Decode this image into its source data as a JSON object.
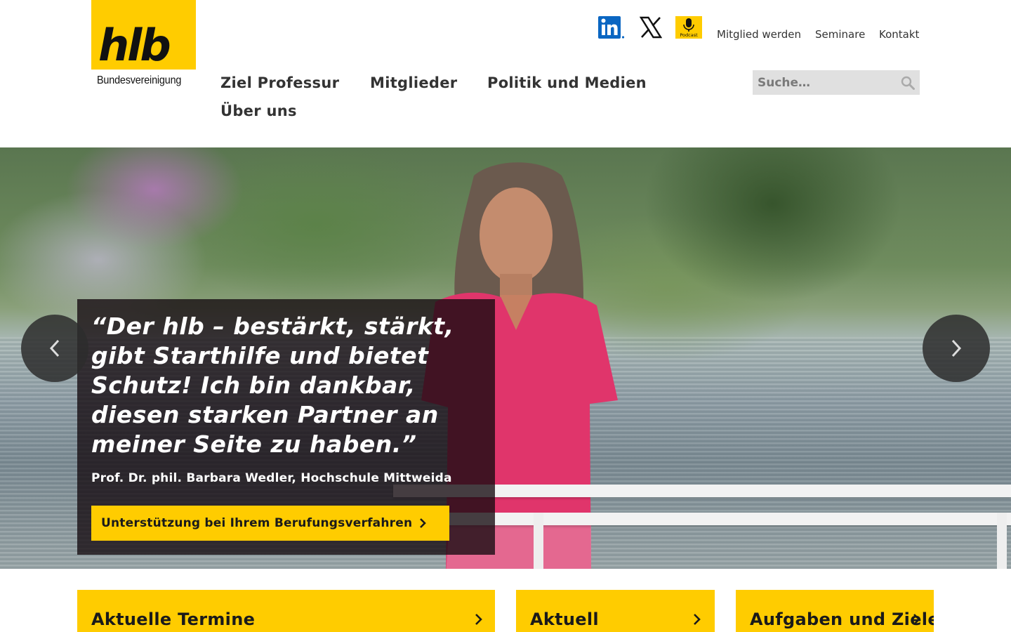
{
  "brand": {
    "wordmark": "hlb",
    "subtitle": "Bundesvereinigung",
    "accent": "#ffcc00"
  },
  "social": [
    {
      "name": "linkedin-icon",
      "label": "in"
    },
    {
      "name": "x-icon",
      "label": "X"
    },
    {
      "name": "podcast-icon",
      "label": "Podcast"
    }
  ],
  "meta_nav": {
    "member": "Mitglied werden",
    "seminars": "Seminare",
    "contact": "Kontakt"
  },
  "main_nav": {
    "items": [
      "Ziel Professur",
      "Mitglieder",
      "Politik und Medien",
      "Über uns"
    ]
  },
  "search": {
    "placeholder": "Suche…"
  },
  "hero": {
    "quote": "“Der hlb – bestärkt, stärkt, gibt Starthilfe und bietet Schutz! Ich bin dankbar, diesen starken Partner an meiner Seite zu haben.”",
    "author": "Prof. Dr. phil. Barbara Wedler, Hochschule Mittweida",
    "cta": "Unterstützung bei Ihrem Berufungsverfahren"
  },
  "cards": [
    "Aktuelle Termine",
    "Aktuell",
    "Aufgaben und Ziele"
  ]
}
